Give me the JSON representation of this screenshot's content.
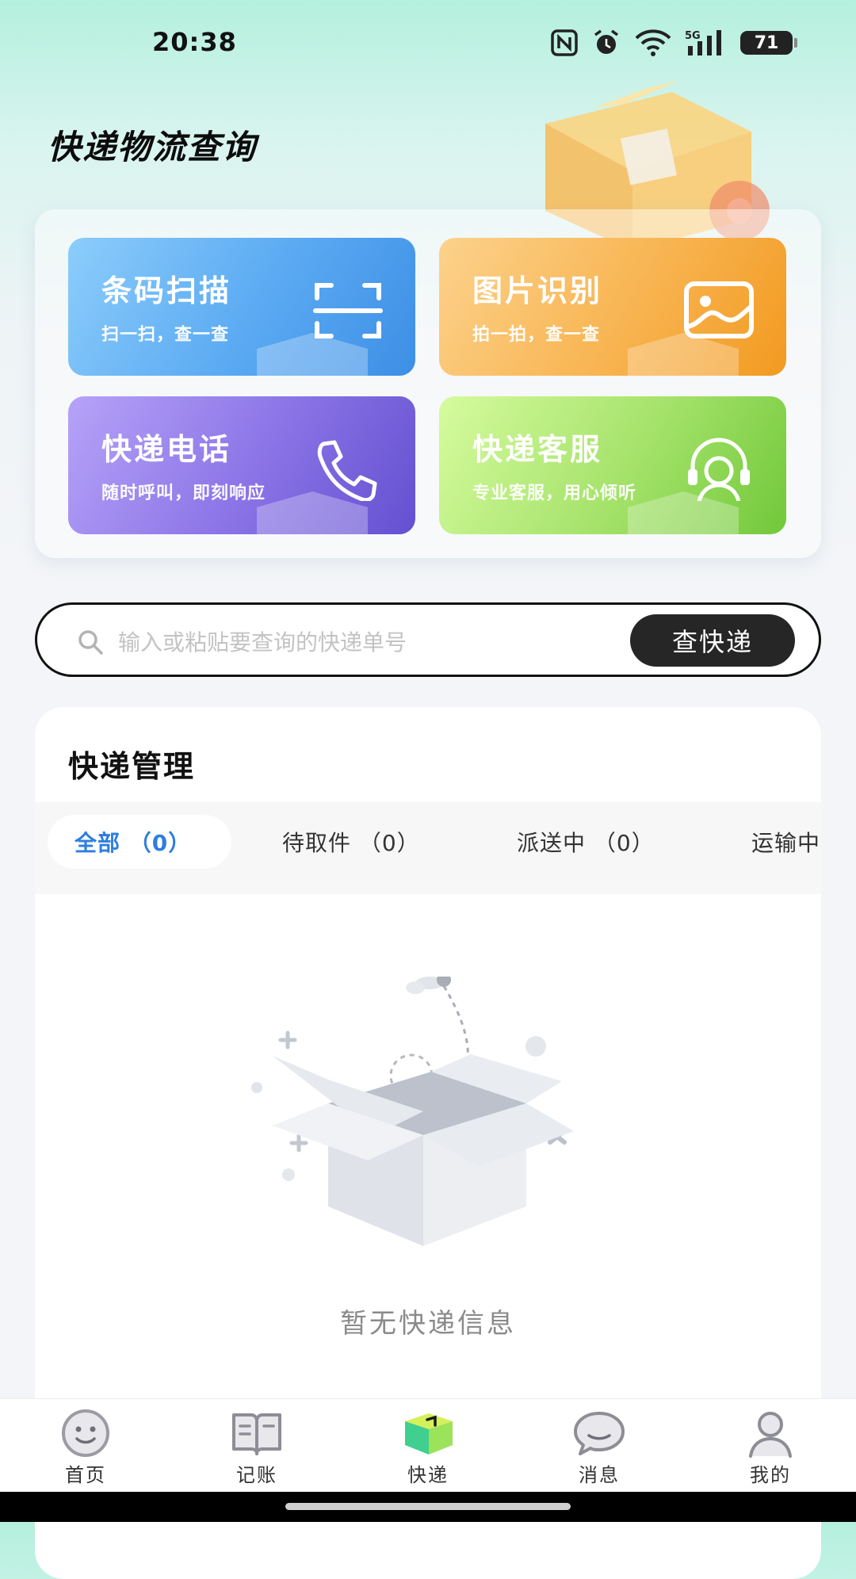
{
  "status_bar": {
    "time": "20:38",
    "battery": "71"
  },
  "header": {
    "title": "快递物流查询"
  },
  "features": [
    {
      "title": "条码扫描",
      "subtitle": "扫一扫，查一查",
      "icon": "scan-icon"
    },
    {
      "title": "图片识别",
      "subtitle": "拍一拍，查一查",
      "icon": "image-icon"
    },
    {
      "title": "快递电话",
      "subtitle": "随时呼叫，即刻响应",
      "icon": "phone-icon"
    },
    {
      "title": "快递客服",
      "subtitle": "专业客服，用心倾听",
      "icon": "headset-icon"
    }
  ],
  "search": {
    "placeholder": "输入或粘贴要查询的快递单号",
    "value": "",
    "button_label": "查快递"
  },
  "management": {
    "title": "快递管理",
    "tabs": [
      {
        "label": "全部 （0）",
        "active": true
      },
      {
        "label": "待取件 （0）",
        "active": false
      },
      {
        "label": "派送中 （0）",
        "active": false
      },
      {
        "label": "运输中",
        "active": false
      }
    ],
    "empty_text": "暂无快递信息"
  },
  "bottom_nav": [
    {
      "label": "首页",
      "icon": "smile-face-icon"
    },
    {
      "label": "记账",
      "icon": "book-icon"
    },
    {
      "label": "快递",
      "icon": "package-cube-icon",
      "active": true
    },
    {
      "label": "消息",
      "icon": "chat-bubble-icon"
    },
    {
      "label": "我的",
      "icon": "user-icon"
    }
  ],
  "colors": {
    "accent_blue": "#2d7ee0",
    "search_button": "#262626"
  }
}
